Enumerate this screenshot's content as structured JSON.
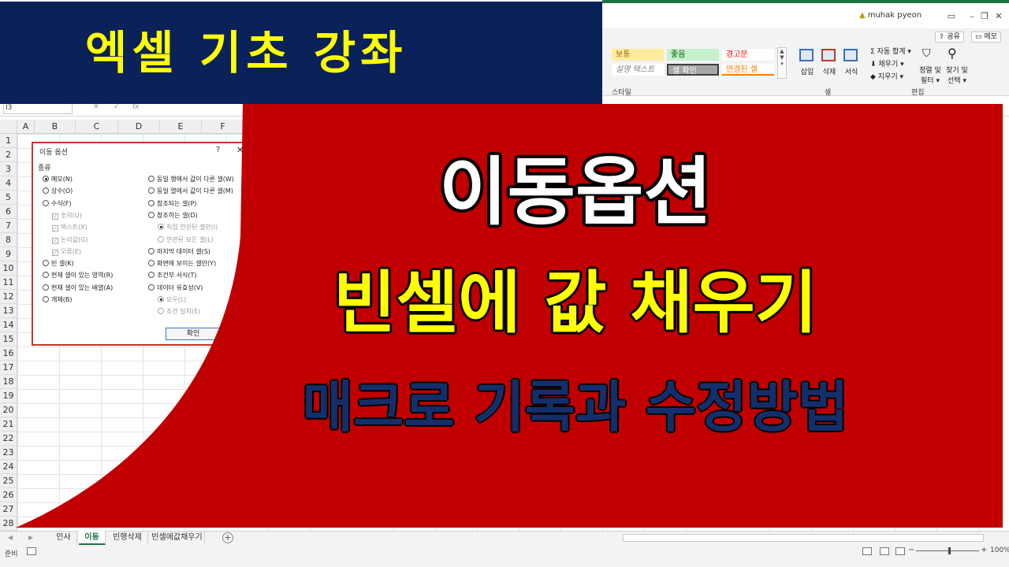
{
  "banner": {
    "title": "엑셀 기초 강좌"
  },
  "overlay": {
    "line1": "이동옵션",
    "line2": "빈셀에 값 채우기",
    "line3": "매크로 기록과 수정방법"
  },
  "titlebar": {
    "user": "muhak pyeon",
    "share_label": "공유",
    "comment_label": "메모"
  },
  "ribbon": {
    "styles": [
      {
        "label": "보통",
        "bg": "#ffeb9c",
        "fg": "#9c6500"
      },
      {
        "label": "좋음",
        "bg": "#c6efce",
        "fg": "#006100"
      },
      {
        "label": "경고문",
        "bg": "#ffffff",
        "fg": "#ff0000"
      },
      {
        "label": "설명 텍스트",
        "bg": "#ffffff",
        "fg": "#7f7f7f"
      },
      {
        "label": "셀 확인",
        "bg": "#a5a5a5",
        "fg": "#ffffff"
      },
      {
        "label": "연결된 셀",
        "bg": "#ffffff",
        "fg": "#fa7d00"
      }
    ],
    "styles_group": "스타일",
    "cells_buttons": [
      "삽입",
      "삭제",
      "서식"
    ],
    "cells_group": "셀",
    "autosum": "자동 합계",
    "fill": "채우기",
    "clear": "지우기",
    "sort_filter": [
      "정렬 및",
      "필터"
    ],
    "find_select": [
      "찾기 및",
      "선택"
    ],
    "editing_group": "편집"
  },
  "formula_bar": {
    "name_box": "I3",
    "fx": "fx"
  },
  "grid": {
    "columns": [
      "A",
      "B",
      "C",
      "D",
      "E",
      "F"
    ],
    "rows": [
      "1",
      "2",
      "3",
      "4",
      "5",
      "6",
      "7",
      "8",
      "9",
      "10",
      "11",
      "12",
      "13",
      "14",
      "15",
      "16",
      "17",
      "18",
      "19",
      "20",
      "21",
      "22",
      "23",
      "24",
      "25",
      "26",
      "27",
      "28"
    ]
  },
  "dialog": {
    "title": "이동 옵션",
    "help": "?",
    "close": "✕",
    "section": "종류",
    "left_options": [
      {
        "label": "메모(N)",
        "type": "radio",
        "checked": true,
        "dim": false
      },
      {
        "label": "상수(O)",
        "type": "radio",
        "checked": false,
        "dim": false
      },
      {
        "label": "수식(F)",
        "type": "radio",
        "checked": false,
        "dim": false
      },
      {
        "label": "숫자(U)",
        "type": "check",
        "checked": true,
        "dim": true
      },
      {
        "label": "텍스트(X)",
        "type": "check",
        "checked": true,
        "dim": true
      },
      {
        "label": "논리값(G)",
        "type": "check",
        "checked": true,
        "dim": true
      },
      {
        "label": "오류(E)",
        "type": "check",
        "checked": true,
        "dim": true
      },
      {
        "label": "빈 셀(K)",
        "type": "radio",
        "checked": false,
        "dim": false
      },
      {
        "label": "현재 셀이 있는 영역(R)",
        "type": "radio",
        "checked": false,
        "dim": false
      },
      {
        "label": "현재 셀이 있는 배열(A)",
        "type": "radio",
        "checked": false,
        "dim": false
      },
      {
        "label": "개체(B)",
        "type": "radio",
        "checked": false,
        "dim": false
      }
    ],
    "right_options": [
      {
        "label": "동일 행에서 값이 다른 셀(W)",
        "dim": false,
        "checked": false
      },
      {
        "label": "동일 열에서 값이 다른 셀(M)",
        "dim": false,
        "checked": false
      },
      {
        "label": "참조되는 셀(P)",
        "dim": false,
        "checked": false
      },
      {
        "label": "참조하는 셀(D)",
        "dim": false,
        "checked": false
      },
      {
        "label": "직접 연관된 셀만(I)",
        "dim": true,
        "checked": true
      },
      {
        "label": "연관된 모든 셀(L)",
        "dim": true,
        "checked": false
      },
      {
        "label": "마지막 데이터 셀(S)",
        "dim": false,
        "checked": false
      },
      {
        "label": "화면에 보이는 셀만(Y)",
        "dim": false,
        "checked": false
      },
      {
        "label": "조건부 서식(T)",
        "dim": false,
        "checked": false
      },
      {
        "label": "데이터 유효성(V)",
        "dim": false,
        "checked": false
      },
      {
        "label": "모두(L)",
        "dim": true,
        "checked": true
      },
      {
        "label": "조건 일치(E)",
        "dim": true,
        "checked": false
      }
    ],
    "ok_label": "확인"
  },
  "sheets": {
    "tabs": [
      "인사",
      "이동",
      "빈행삭제",
      "빈셀에값채우기"
    ],
    "active": "이동",
    "add": "+"
  },
  "status": {
    "ready": "준비",
    "zoom": "100%",
    "zoom_level_percent": 100
  },
  "colors": {
    "banner_bg": "#0a2159",
    "banner_text": "#ffff00",
    "red_panel": "#c00000",
    "excel_green": "#217346"
  }
}
